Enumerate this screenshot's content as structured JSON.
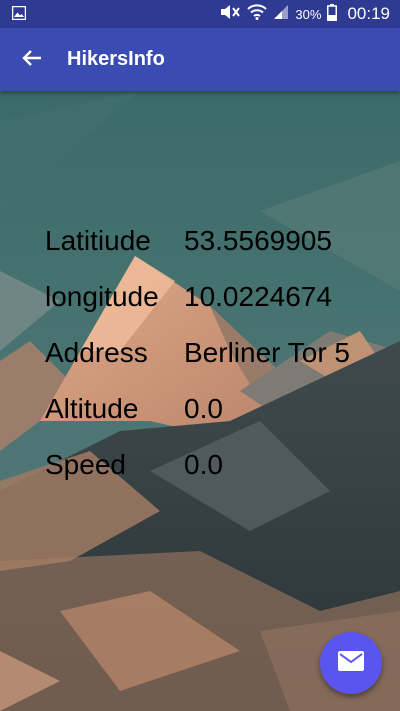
{
  "status_bar": {
    "left_icon": "image-icon",
    "icons": [
      "mute-icon",
      "wifi-icon",
      "signal-icon",
      "battery-icon"
    ],
    "battery_percent": "30%",
    "time": "00:19"
  },
  "app_bar": {
    "back_icon": "arrow-left-icon",
    "title": "HikersInfo"
  },
  "info": {
    "rows": [
      {
        "label": "Latitiude",
        "value": "53.5569905"
      },
      {
        "label": "longitude",
        "value": "10.0224674"
      },
      {
        "label": "Address",
        "value": "Berliner Tor 5"
      },
      {
        "label": "Altitude",
        "value": "0.0"
      },
      {
        "label": "Speed",
        "value": "0.0"
      }
    ]
  },
  "fab": {
    "icon": "mail-icon"
  },
  "colors": {
    "status_bar": "#2f3a93",
    "app_bar": "#3a4cb1",
    "fab": "#5b55f0",
    "sky": "#3f6e6a",
    "mountain": "#c89378"
  }
}
